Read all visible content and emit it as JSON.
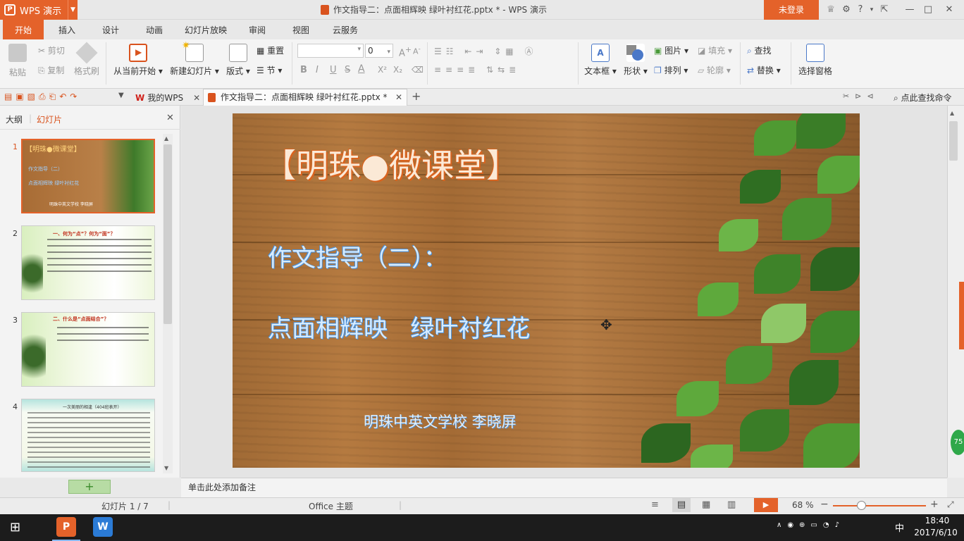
{
  "app": {
    "name": "WPS 演示",
    "window_title": "作文指导二：点面相辉映 绿叶衬红花.pptx * - WPS 演示",
    "login": "未登录"
  },
  "tabs": [
    "开始",
    "插入",
    "设计",
    "动画",
    "幻灯片放映",
    "审阅",
    "视图",
    "云服务"
  ],
  "ribbon": {
    "paste": "粘贴",
    "cut": "剪切",
    "copy": "复制",
    "format_painter": "格式刷",
    "from_current": "从当前开始",
    "new_slide": "新建幻灯片",
    "layout": "版式",
    "reset": "重置",
    "section": "节",
    "font_size": "0",
    "textbox": "文本框",
    "shape": "形状",
    "picture": "图片",
    "fill": "填充",
    "arrange": "排列",
    "outline": "轮廓",
    "find": "查找",
    "replace": "替换",
    "select_pane": "选择窗格"
  },
  "qbar": {
    "my_wps": "我的WPS",
    "doc_tab": "作文指导二：点面相辉映 绿叶衬红花.pptx *",
    "search_cmd": "点此查找命令"
  },
  "leftpane": {
    "outline": "大纲",
    "slides": "幻灯片"
  },
  "thumbs": [
    {
      "num": "1",
      "title": "【明珠●微课堂】",
      "l1": "作文指导（二）",
      "l2": "点面相辉映 绿叶衬红花",
      "l3": "明珠中英文学校 李晓屏"
    },
    {
      "num": "2",
      "title": "一、何为“点”？何为“面”？"
    },
    {
      "num": "3",
      "title": "二、什么是“点面结合”？"
    },
    {
      "num": "4",
      "title": "一次美丽的相逢（404班表开）"
    }
  ],
  "slide": {
    "title": "【明珠●微课堂】",
    "line1": "作文指导（二）：",
    "line2": "点面相辉映   绿叶衬红花",
    "author": "明珠中英文学校 李晓屏"
  },
  "notes": "单击此处添加备注",
  "status": {
    "slide_count": "幻灯片 1 / 7",
    "theme": "Office 主题",
    "zoom": "68 %",
    "badge": "75"
  },
  "taskbar": {
    "time": "18:40",
    "date": "2017/6/10",
    "ime": "中"
  }
}
